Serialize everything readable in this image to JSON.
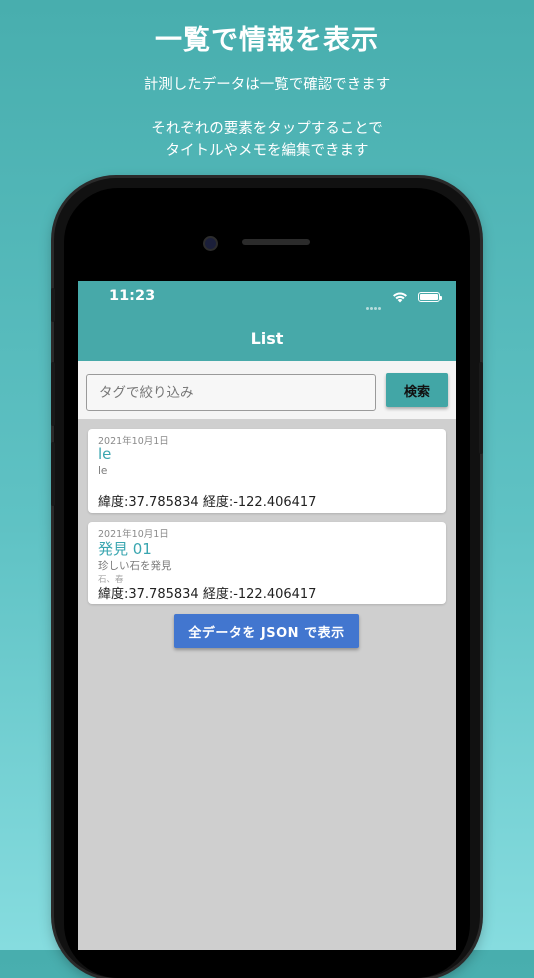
{
  "promo": {
    "headline": "一覧で情報を表示",
    "subtext1": "計測したデータは一覧で確認できます",
    "subtext2_line1": "それぞれの要素をタップすることで",
    "subtext2_line2": "タイトルやメモを編集できます"
  },
  "status_bar": {
    "time": "11:23"
  },
  "header": {
    "title": "List"
  },
  "search": {
    "placeholder": "タグで絞り込み",
    "value": "",
    "button_label": "検索"
  },
  "records": [
    {
      "date": "2021年10月1日",
      "title": "le",
      "memo": "le",
      "tags": "",
      "coords": "緯度:37.785834 経度:-122.406417"
    },
    {
      "date": "2021年10月1日",
      "title": "発見 01",
      "memo": "珍しい石を発見",
      "tags": "石、春",
      "coords": "緯度:37.785834 経度:-122.406417"
    }
  ],
  "json_button": {
    "label": "全データを JSON で表示"
  },
  "colors": {
    "accent": "#47a9a9",
    "title_link": "#3aa6b0",
    "primary_button": "#4276cf"
  }
}
